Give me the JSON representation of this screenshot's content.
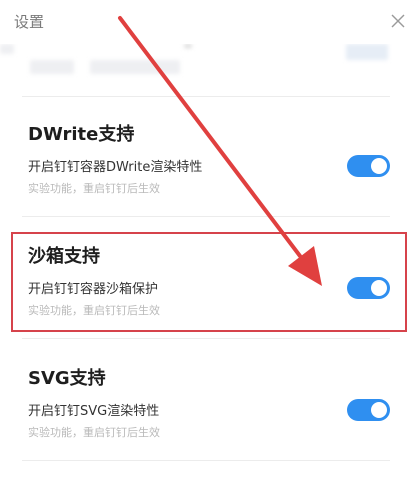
{
  "window": {
    "title": "设置"
  },
  "sections": [
    {
      "title": "DWrite支持",
      "description": "开启钉钉容器DWrite渲染特性",
      "note": "实验功能，重启钉钉后生效",
      "enabled": true
    },
    {
      "title": "沙箱支持",
      "description": "开启钉钉容器沙箱保护",
      "note": "实验功能，重启钉钉后生效",
      "enabled": true
    },
    {
      "title": "SVG支持",
      "description": "开启钉钉SVG渲染特性",
      "note": "实验功能，重启钉钉后生效",
      "enabled": true
    }
  ],
  "colors": {
    "toggle_on": "#2f8ff0",
    "highlight": "#d6434b",
    "arrow": "#e0403f"
  },
  "icons": {
    "close": "close-icon"
  }
}
